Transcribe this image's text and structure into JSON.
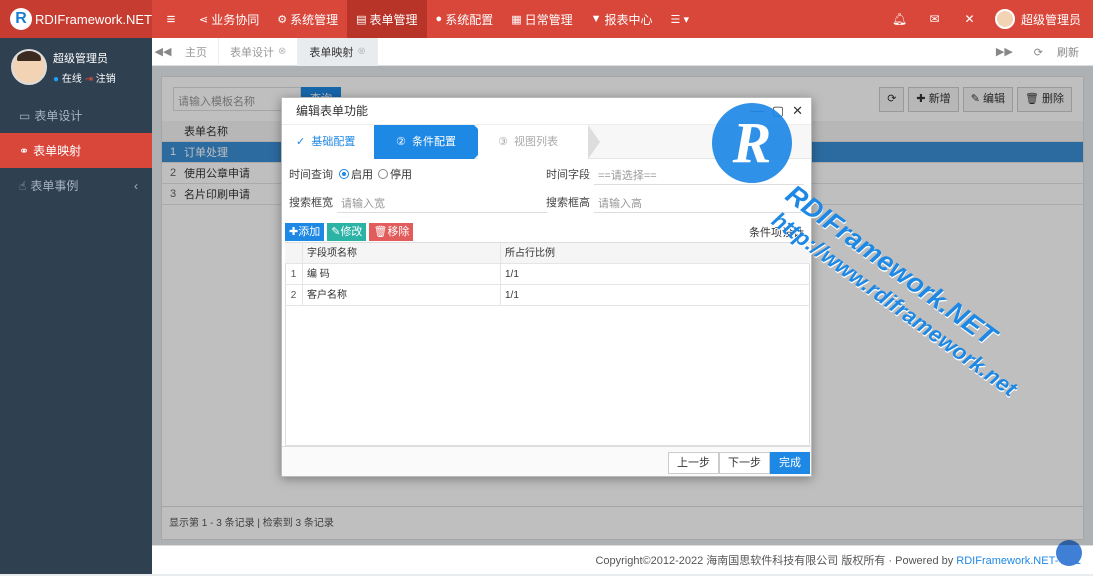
{
  "app": {
    "logo_letter": "R",
    "name": "RDIFramework.NET"
  },
  "topnav": {
    "menu_icon": "≡",
    "items": [
      {
        "label": "业务协同",
        "icon": "share-icon"
      },
      {
        "label": "系统管理",
        "icon": "cogs-icon"
      },
      {
        "label": "表单管理",
        "icon": "form-icon",
        "active": true
      },
      {
        "label": "系统配置",
        "icon": "dot-icon"
      },
      {
        "label": "日常管理",
        "icon": "calendar-icon"
      },
      {
        "label": "报表中心",
        "icon": "filter-icon"
      },
      {
        "label": "",
        "icon": "list-icon"
      }
    ],
    "user_name": "超级管理员"
  },
  "sidebar": {
    "profile_name": "超级管理员",
    "status_online": "在线",
    "status_logout": "注销",
    "items": [
      {
        "label": "表单设计",
        "icon": "form-icon"
      },
      {
        "label": "表单映射",
        "icon": "link-icon",
        "active": true
      },
      {
        "label": "表单事例",
        "icon": "thumbs-up-icon"
      }
    ]
  },
  "tabs": {
    "items": [
      {
        "label": "主页"
      },
      {
        "label": "表单设计"
      },
      {
        "label": "表单映射",
        "active": true
      }
    ],
    "refresh_label": "刷新"
  },
  "main": {
    "search_placeholder": "请输入模板名称",
    "search_button": "查询",
    "toolbar": {
      "add": "新增",
      "edit": "编辑",
      "delete": "删除"
    },
    "grid": {
      "header": "表单名称",
      "rows": [
        {
          "num": "1",
          "name": "订单处理",
          "selected": true
        },
        {
          "num": "2",
          "name": "使用公章申请"
        },
        {
          "num": "3",
          "name": "名片印刷申请"
        }
      ]
    },
    "pager_text": "显示第 1 - 3 条记录 | 检索到 3 条记录"
  },
  "dialog": {
    "title": "编辑表单功能",
    "steps": [
      {
        "icon": "✓",
        "label": "基础配置"
      },
      {
        "icon": "②",
        "label": "条件配置"
      },
      {
        "icon": "③",
        "label": "视图列表"
      }
    ],
    "form": {
      "time_query_label": "时间查询",
      "enable_label": "启用",
      "disable_label": "停用",
      "time_field_label": "时间字段",
      "time_field_placeholder": "==请选择==",
      "search_width_label": "搜索框宽",
      "search_width_placeholder": "请输入宽",
      "search_height_label": "搜索框高",
      "search_height_placeholder": "请输入高"
    },
    "toolbar": {
      "add": "添加",
      "edit": "修改",
      "remove": "移除",
      "design": "条件项设计"
    },
    "grid": {
      "headers": [
        "字段项名称",
        "所占行比例"
      ],
      "rows": [
        {
          "num": "1",
          "name": "编 码",
          "ratio": "1/1"
        },
        {
          "num": "2",
          "name": "客户名称",
          "ratio": "1/1"
        }
      ]
    },
    "footer": {
      "prev": "上一步",
      "next": "下一步",
      "finish": "完成"
    }
  },
  "footer": {
    "copyright": "Copyright©2012-2022 海南国思软件科技有限公司 版权所有 · Powered by ",
    "link": "RDIFramework.NET-V5.1"
  },
  "watermark": {
    "letter": "R",
    "line1": "RDIFramework.NET",
    "line2": "http://www.rdiframework.net"
  }
}
